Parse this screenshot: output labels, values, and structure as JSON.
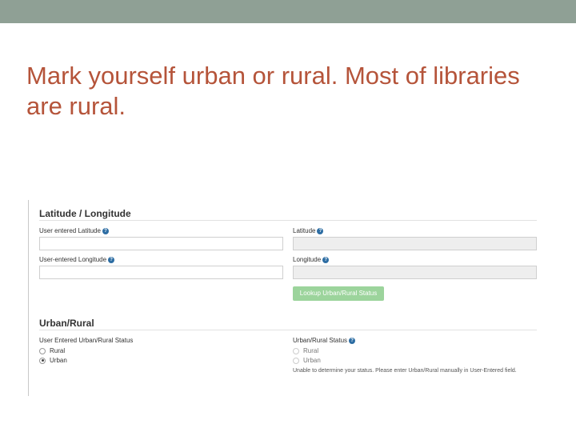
{
  "slide": {
    "title": "Mark yourself urban or rural. Most of libraries are rural."
  },
  "latlong": {
    "section_title": "Latitude / Longitude",
    "user_latitude_label": "User entered Latitude",
    "user_longitude_label": "User-entered Longitude",
    "latitude_label": "Latitude",
    "longitude_label": "Longitude",
    "user_latitude_value": "",
    "user_longitude_value": "",
    "latitude_value": "",
    "longitude_value": "",
    "lookup_button": "Lookup Urban/Rural Status"
  },
  "urbanrural": {
    "section_title": "Urban/Rural",
    "user_status_label": "User Entered Urban/Rural Status",
    "user_options": [
      {
        "label": "Rural",
        "checked": false
      },
      {
        "label": "Urban",
        "checked": true
      }
    ],
    "status_label": "Urban/Rural Status",
    "status_options": [
      {
        "label": "Rural",
        "checked": false
      },
      {
        "label": "Urban",
        "checked": false
      }
    ],
    "status_note": "Unable to determine your status. Please enter Urban/Rural manually in User-Entered field."
  },
  "colors": {
    "top_bar": "#8fa095",
    "title": "#b5543a",
    "button": "#5cb85c",
    "help_icon": "#2d6da3"
  },
  "icons": {
    "help": "question-circle-icon"
  }
}
